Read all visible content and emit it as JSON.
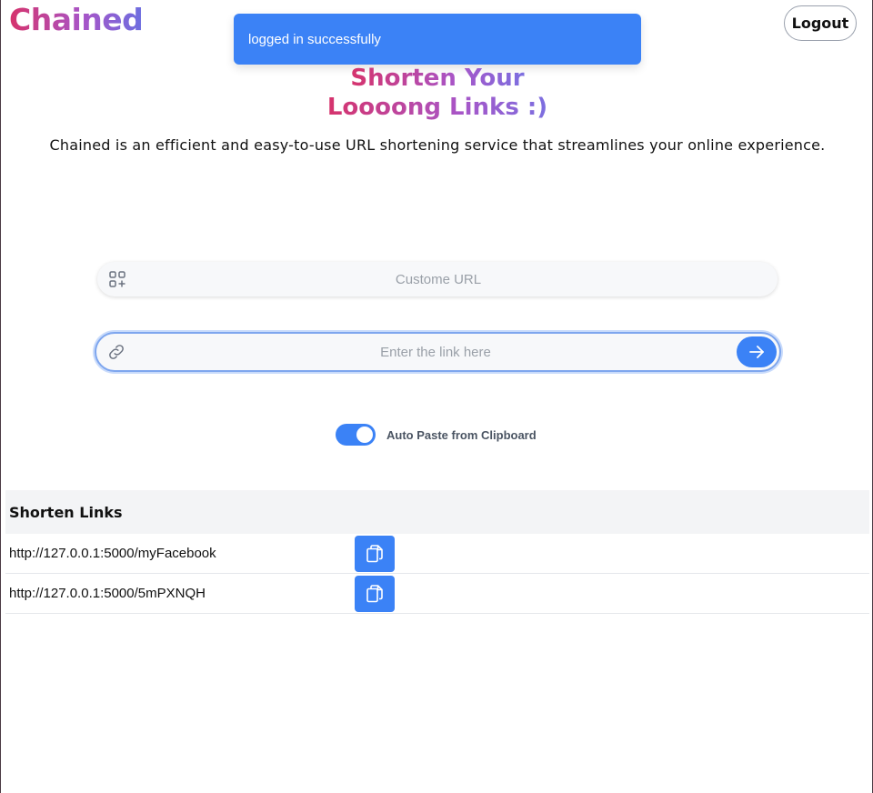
{
  "header": {
    "logo": "Chained",
    "logout_label": "Logout"
  },
  "toast": {
    "message": "logged in successfully"
  },
  "hero": {
    "headline_line1": "Shorten Your",
    "headline_line2": "Loooong Links :)",
    "tagline": "Chained is an efficient and easy-to-use URL shortening service that streamlines your online experience."
  },
  "form": {
    "custom_url_placeholder": "Custome URL",
    "link_placeholder": "Enter the link here",
    "auto_paste_label": "Auto Paste from Clipboard",
    "auto_paste_enabled": true
  },
  "links": {
    "header": "Shorten Links",
    "items": [
      {
        "url": "http://127.0.0.1:5000/myFacebook"
      },
      {
        "url": "http://127.0.0.1:5000/5mPXNQH"
      }
    ]
  },
  "colors": {
    "accent": "#3b82f6",
    "gradient_start": "#d6336c",
    "gradient_end": "#6d6ee0"
  },
  "icons": {
    "custom_url": "apps-add-icon",
    "link": "link-icon",
    "submit": "arrow-right-icon",
    "copy": "copy-icon"
  }
}
